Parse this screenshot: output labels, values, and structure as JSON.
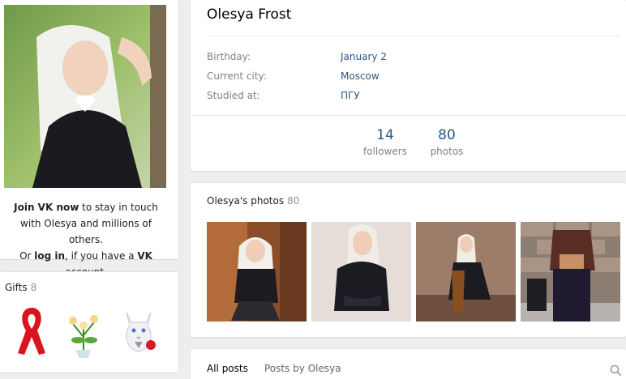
{
  "profile": {
    "name": "Olesya Frost",
    "join_bold": "Join VK now",
    "join_rest": " to stay in touch with Olesya and millions of others.",
    "or_text": "Or ",
    "login_link": "log in",
    "login_rest": ", if you have a ",
    "vk_bold": "VK",
    "account_text": " account."
  },
  "info": {
    "rows": [
      {
        "label": "Birthday:",
        "value": "January 2"
      },
      {
        "label": "Current city:",
        "value": "Moscow"
      },
      {
        "label": "Studied at:",
        "value": "ПГУ"
      }
    ]
  },
  "counters": [
    {
      "num": "14",
      "label": "followers"
    },
    {
      "num": "80",
      "label": "photos"
    }
  ],
  "photos": {
    "title": "Olesya's photos",
    "count": "80"
  },
  "gifts": {
    "title": "Gifts",
    "count": "8",
    "items": [
      "ribbon-gift-icon",
      "flowers-gift-icon",
      "cat-gift-icon"
    ]
  },
  "posts": {
    "tab_all": "All posts",
    "tab_owner": "Posts by Olesya"
  },
  "colors": {
    "link": "#2a5885",
    "muted": "#828282",
    "background": "#edeef0"
  }
}
